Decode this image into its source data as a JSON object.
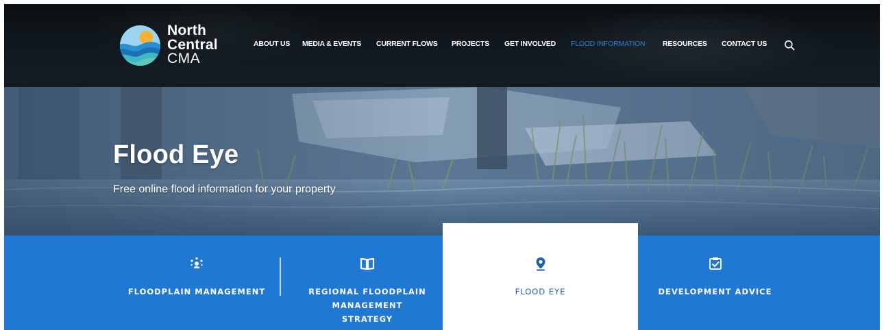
{
  "brand": {
    "line1": "North",
    "line2": "Central",
    "line3": "CMA"
  },
  "nav": {
    "items": [
      {
        "label": "ABOUT US",
        "active": false
      },
      {
        "label": "MEDIA & EVENTS",
        "active": false
      },
      {
        "label": "CURRENT FLOWS",
        "active": false
      },
      {
        "label": "PROJECTS",
        "active": false
      },
      {
        "label": "GET INVOLVED",
        "active": false
      },
      {
        "label": "FLOOD INFORMATION",
        "active": true
      },
      {
        "label": "RESOURCES",
        "active": false
      },
      {
        "label": "CONTACT US",
        "active": false
      }
    ],
    "search_icon": "search-icon"
  },
  "hero": {
    "title": "Flood Eye",
    "subtitle": "Free online flood information for your property"
  },
  "tabs": [
    {
      "label": "FLOODPLAIN MANAGEMENT",
      "icon": "people-network-icon",
      "active": false
    },
    {
      "label": "REGIONAL FLOODPLAIN MANAGEMENT STRATEGY",
      "icon": "book-icon",
      "active": false
    },
    {
      "label": "FLOOD EYE",
      "icon": "map-pin-icon",
      "active": true
    },
    {
      "label": "DEVELOPMENT ADVICE",
      "icon": "checklist-icon",
      "active": false
    }
  ],
  "colors": {
    "header_bg": "#0f161b",
    "nav_active": "#2f7fd6",
    "tabs_bg": "#1f78d2",
    "active_tab_text": "#1f5fa8",
    "logo_blue": "#2a8fd0",
    "logo_sun": "#f6b133"
  }
}
